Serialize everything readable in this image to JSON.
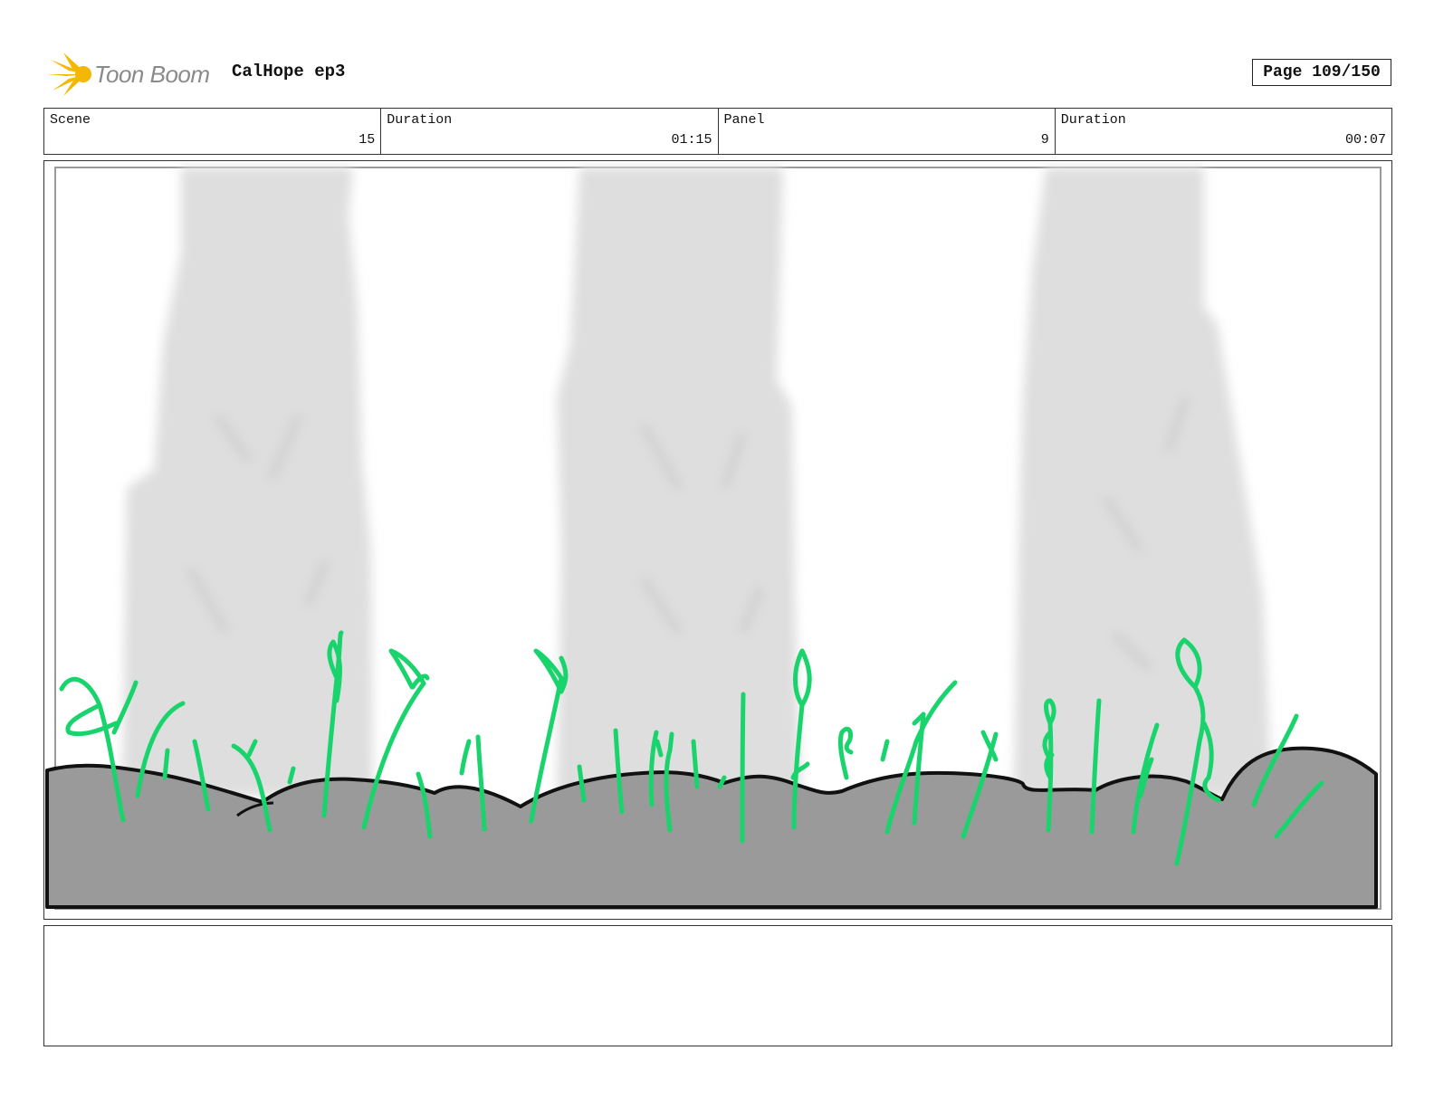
{
  "header": {
    "logo_text": "Toon Boom",
    "project_title": "CalHope ep3",
    "page_label": "Page 109/150"
  },
  "info": {
    "scene_label": "Scene",
    "scene_value": "15",
    "scene_duration_label": "Duration",
    "scene_duration_value": "01:15",
    "panel_label": "Panel",
    "panel_value": "9",
    "panel_duration_label": "Duration",
    "panel_duration_value": "00:07"
  },
  "colors": {
    "grass": "#19d46c",
    "ground": "#9a9a9a",
    "tree": "#dedede",
    "logo_star": "#f5b800"
  },
  "notes": ""
}
